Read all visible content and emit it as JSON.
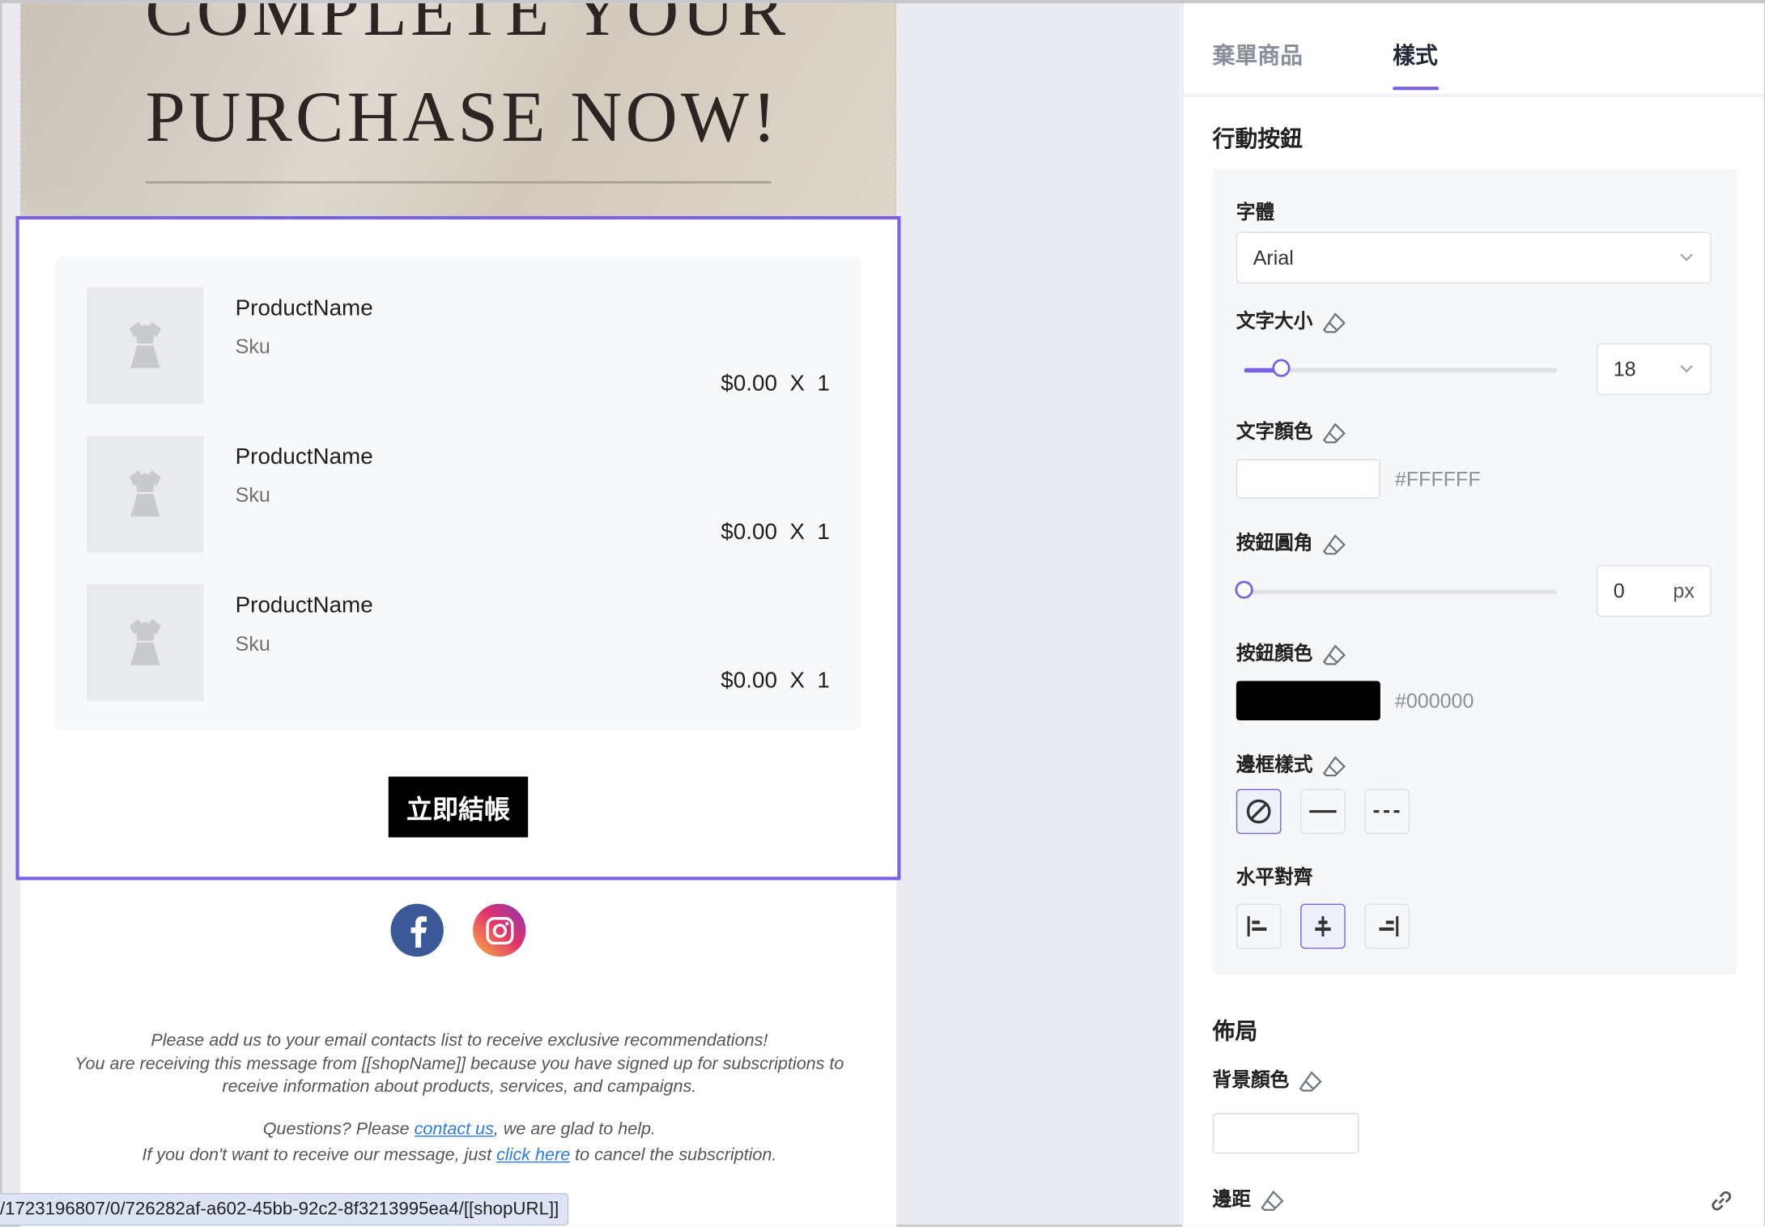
{
  "banner": {
    "line1": "COMPLETE YOUR",
    "line2": "PURCHASE NOW!"
  },
  "products": [
    {
      "name": "ProductName",
      "sku": "Sku",
      "price": "$0.00",
      "qty": "X  1"
    },
    {
      "name": "ProductName",
      "sku": "Sku",
      "price": "$0.00",
      "qty": "X  1"
    },
    {
      "name": "ProductName",
      "sku": "Sku",
      "price": "$0.00",
      "qty": "X  1"
    }
  ],
  "cta_label": "立即結帳",
  "footer": {
    "line1": "Please add us to your email contacts list to receive exclusive recommendations!",
    "line2": "You are receiving this message from [[shopName]] because you have signed up for subscriptions to receive information about products, services, and campaigns.",
    "q_prefix": "Questions? Please ",
    "q_link": "contact us",
    "q_suffix": ", we are glad to help.",
    "u_prefix": "If you don't want to receive our message, just ",
    "u_link": "click here",
    "u_suffix": " to cancel the subscription."
  },
  "status_url": "/1723196807/0/726282af-a602-45bb-92c2-8f3213995ea4/[[shopURL]]",
  "panel": {
    "tabs": [
      {
        "label": "棄單商品",
        "active": false
      },
      {
        "label": "樣式",
        "active": true
      }
    ],
    "section_action": "行動按鈕",
    "font_label": "字體",
    "font_value": "Arial",
    "size_label": "文字大小",
    "size_value": "18",
    "size_fraction": 0.12,
    "text_color_label": "文字顏色",
    "text_color_hex": "#FFFFFF",
    "radius_label": "按鈕圓角",
    "radius_value": "0",
    "radius_unit": "px",
    "btn_color_label": "按鈕顏色",
    "btn_color_hex": "#000000",
    "border_label": "邊框樣式",
    "align_label": "水平對齊",
    "section_layout": "佈局",
    "bg_color_label": "背景顏色",
    "margin_label": "邊距",
    "accent": "#7B61E8"
  }
}
